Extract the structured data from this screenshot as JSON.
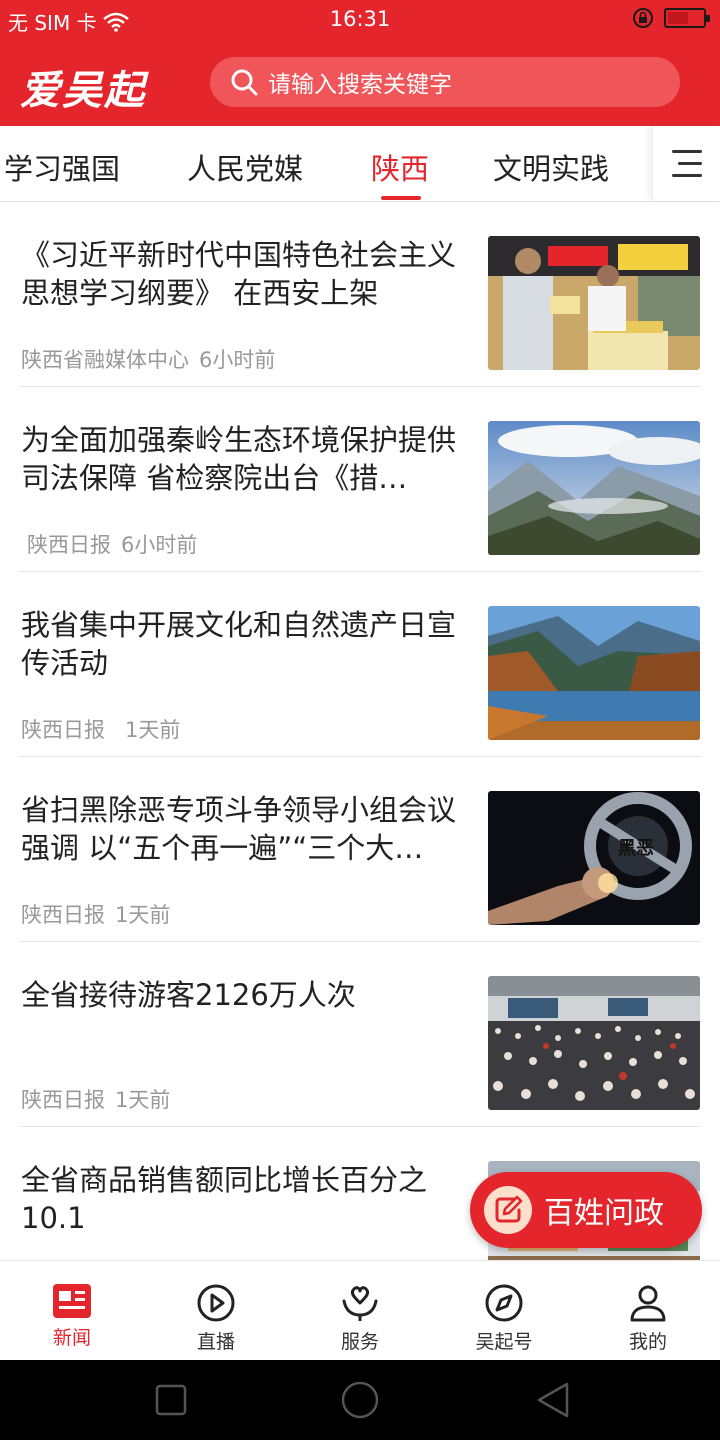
{
  "status_bar": {
    "carrier": "无 SIM 卡",
    "time": "16:31",
    "battery_level": 0.6
  },
  "header": {
    "logo_text": "爱吴起",
    "search_placeholder": "请输入搜索关键字"
  },
  "tabs": [
    {
      "label": "学习强国",
      "active": false
    },
    {
      "label": "人民党媒",
      "active": false
    },
    {
      "label": "陕西",
      "active": true
    },
    {
      "label": "文明实践",
      "active": false
    }
  ],
  "news": [
    {
      "title": "《习近平新时代中国特色社会主义思想学习纲要》 在西安上架",
      "source": "陕西省融媒体中心",
      "time": "6小时前",
      "image": "bookstore-photo"
    },
    {
      "title": "为全面加强秦岭生态环境保护提供司法保障  省检察院出台《措…",
      "source": "陕西日报",
      "time": "6小时前",
      "image": "mountain-photo"
    },
    {
      "title": "我省集中开展文化和自然遗产日宣传活动",
      "source": "陕西日报",
      "time": "1天前",
      "image": "lake-photo"
    },
    {
      "title": "省扫黑除恶专项斗争领导小组会议强调 以“五个再一遍”“三个大…",
      "source": "陕西日报",
      "time": "1天前",
      "image": "fist-photo"
    },
    {
      "title": "全省接待游客2126万人次",
      "source": "陕西日报",
      "time": "1天前",
      "image": "crowd-photo"
    },
    {
      "title": "全省商品销售额同比增长百分之10.1",
      "source": "",
      "time": "",
      "image": "market-photo"
    }
  ],
  "fab": {
    "label": "百姓问政"
  },
  "bottom_nav": [
    {
      "label": "新闻",
      "icon": "news-icon",
      "active": true
    },
    {
      "label": "直播",
      "icon": "play-icon",
      "active": false
    },
    {
      "label": "服务",
      "icon": "service-icon",
      "active": false
    },
    {
      "label": "吴起号",
      "icon": "compass-icon",
      "active": false
    },
    {
      "label": "我的",
      "icon": "user-icon",
      "active": false
    }
  ],
  "colors": {
    "brand": "#e4262c",
    "meta_text": "#999999"
  }
}
